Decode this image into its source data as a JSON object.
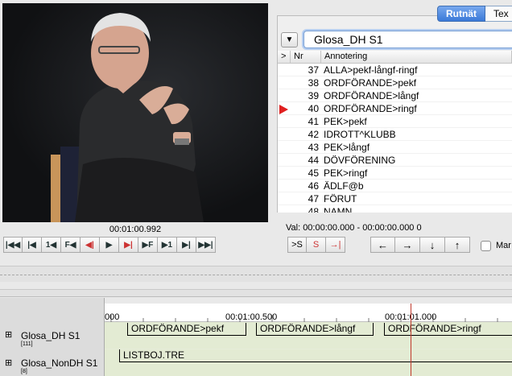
{
  "video": {
    "timecode": "00:01:00.992"
  },
  "media_controls": {
    "buttons": [
      "|◀◀",
      "|◀",
      "1◀",
      "F◀",
      "◀|",
      "▶",
      "▶|",
      "▶F",
      "▶1",
      "▶|",
      "▶▶|"
    ]
  },
  "tabs": [
    {
      "label": "Rutnät"
    },
    {
      "label": "Tex"
    }
  ],
  "grid": {
    "tier_dropdown": "▼",
    "tier": "Glosa_DH S1",
    "headers": {
      "c0": ">",
      "c1": "Nr",
      "c2": "Annotering"
    },
    "current_nr": "40",
    "rows": [
      {
        "nr": "37",
        "text": "ALLA>pekf-långf-ringf"
      },
      {
        "nr": "38",
        "text": "ORDFÖRANDE>pekf"
      },
      {
        "nr": "39",
        "text": "ORDFÖRANDE>långf"
      },
      {
        "nr": "40",
        "text": "ORDFÖRANDE>ringf"
      },
      {
        "nr": "41",
        "text": "PEK>pekf"
      },
      {
        "nr": "42",
        "text": "IDROTT^KLUBB"
      },
      {
        "nr": "43",
        "text": "PEK>långf"
      },
      {
        "nr": "44",
        "text": "DÖVFÖRENING"
      },
      {
        "nr": "45",
        "text": "PEK>ringf"
      },
      {
        "nr": "46",
        "text": "ÄDLF@b"
      },
      {
        "nr": "47",
        "text": "FÖRUT"
      },
      {
        "nr": "48",
        "text": "NAMN"
      }
    ]
  },
  "selection": {
    "label": "Val: 00:00:00.000 - 00:00:00.000  0"
  },
  "selection_buttons": [
    ">S",
    "S",
    "→|"
  ],
  "nav_buttons": [
    "←",
    "→",
    "↓",
    "↑"
  ],
  "mode_checkbox": {
    "label": "Mar",
    "checked": false
  },
  "timeline": {
    "ruler_labels": [
      "000",
      "00:01:00.500",
      "00:01:01.000"
    ],
    "tiers": [
      {
        "name": "Glosa_DH S1",
        "count": "[111]",
        "annotations": [
          "ORDFÖRANDE>pekf",
          "ORDFÖRANDE>långf",
          "ORDFÖRANDE>ringf"
        ]
      },
      {
        "name": "Glosa_NonDH S1",
        "count": "[8]",
        "annotations": [
          "LISTBOJ.TRE"
        ]
      }
    ]
  }
}
